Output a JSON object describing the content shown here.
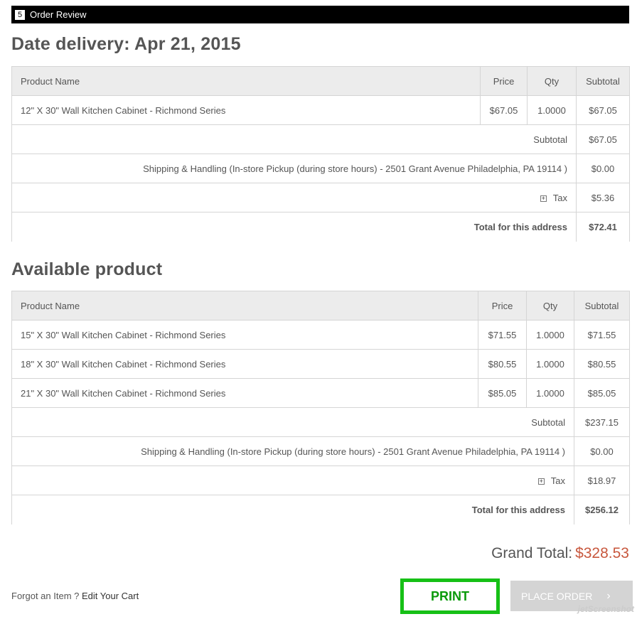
{
  "step": {
    "number": "5",
    "label": "Order Review"
  },
  "delivery": {
    "title": "Date delivery: Apr 21, 2015",
    "headers": {
      "name": "Product Name",
      "price": "Price",
      "qty": "Qty",
      "subtotal": "Subtotal"
    },
    "items": [
      {
        "name": "12\" X 30\" Wall Kitchen Cabinet - Richmond Series",
        "price": "$67.05",
        "qty": "1.0000",
        "subtotal": "$67.05"
      }
    ],
    "subtotal_label": "Subtotal",
    "subtotal_value": "$67.05",
    "shipping_label": "Shipping & Handling (In-store Pickup (during store hours) - 2501 Grant Avenue Philadelphia, PA 19114 )",
    "shipping_value": "$0.00",
    "tax_label": "Tax",
    "tax_value": "$5.36",
    "total_label": "Total for this address",
    "total_value": "$72.41"
  },
  "available": {
    "title": "Available product",
    "headers": {
      "name": "Product Name",
      "price": "Price",
      "qty": "Qty",
      "subtotal": "Subtotal"
    },
    "items": [
      {
        "name": "15\" X 30\" Wall Kitchen Cabinet - Richmond Series",
        "price": "$71.55",
        "qty": "1.0000",
        "subtotal": "$71.55"
      },
      {
        "name": "18\" X 30\" Wall Kitchen Cabinet - Richmond Series",
        "price": "$80.55",
        "qty": "1.0000",
        "subtotal": "$80.55"
      },
      {
        "name": "21\" X 30\" Wall Kitchen Cabinet - Richmond Series",
        "price": "$85.05",
        "qty": "1.0000",
        "subtotal": "$85.05"
      }
    ],
    "subtotal_label": "Subtotal",
    "subtotal_value": "$237.15",
    "shipping_label": "Shipping & Handling (In-store Pickup (during store hours) - 2501 Grant Avenue Philadelphia, PA 19114 )",
    "shipping_value": "$0.00",
    "tax_label": "Tax",
    "tax_value": "$18.97",
    "total_label": "Total for this address",
    "total_value": "$256.12"
  },
  "grand_total": {
    "label": "Grand Total:",
    "value": "$328.53"
  },
  "footer": {
    "forgot_text": "Forgot an Item ?",
    "edit_cart": "Edit Your Cart",
    "print_label": "PRINT",
    "place_order_label": "PLACE ORDER",
    "watermark": "jetScreenshot"
  },
  "colors": {
    "price": "#c8583e",
    "print_border": "#16c016",
    "header_bg": "#ececec"
  },
  "icons": {
    "tax_toggle": "plus-box-icon",
    "place_chevron": "chevron-right-icon"
  }
}
